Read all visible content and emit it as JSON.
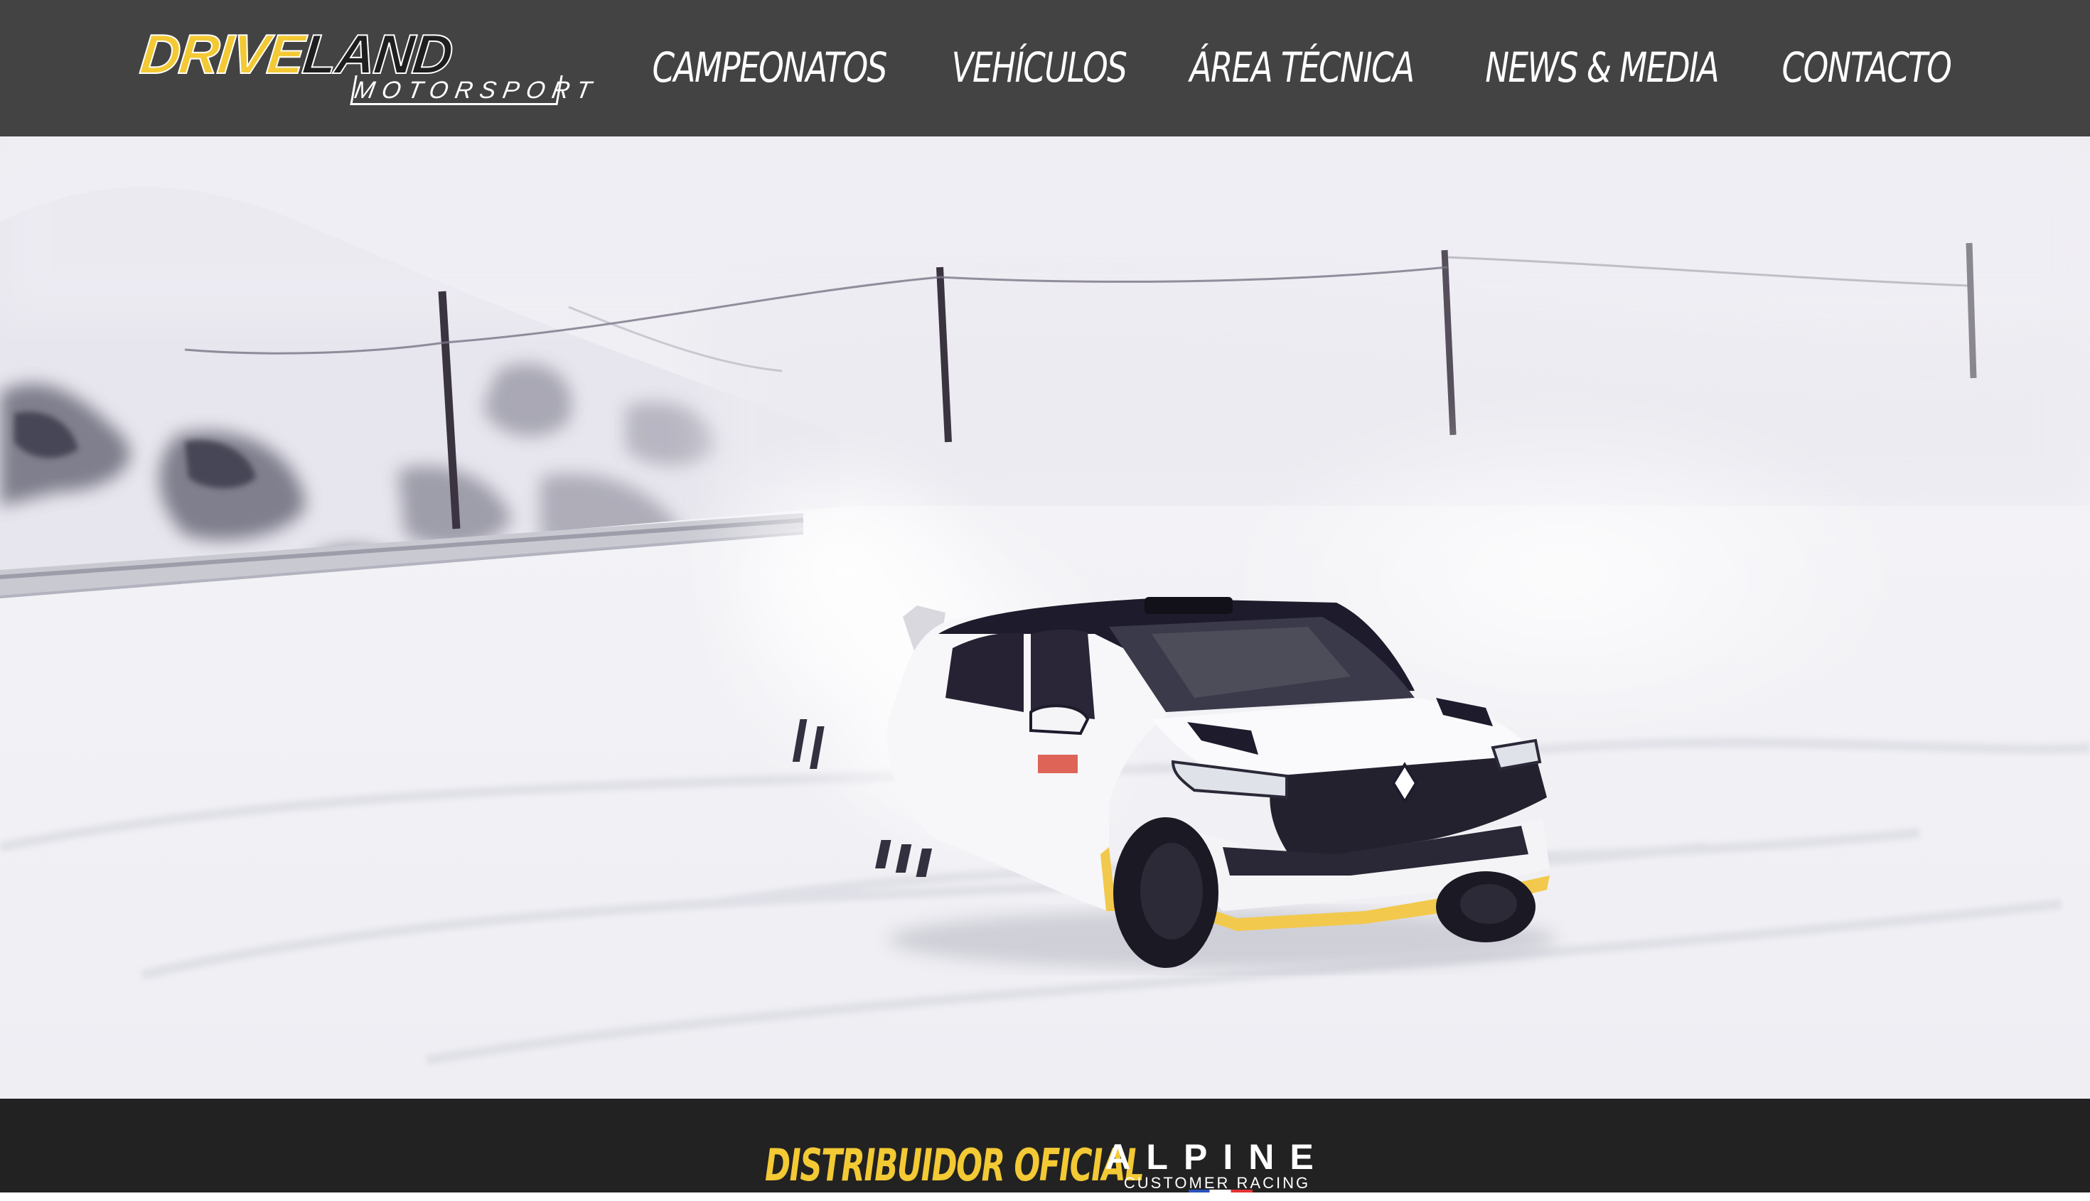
{
  "brand": {
    "logo_part1": "DRIVE",
    "logo_part2": "LAND",
    "logo_sub": "MOTORSPORT"
  },
  "nav": {
    "items": [
      {
        "label": "CAMPEONATOS"
      },
      {
        "label": "VEHÍCULOS"
      },
      {
        "label": "ÁREA TÉCNICA"
      },
      {
        "label": "NEWS & MEDIA"
      },
      {
        "label": "CONTACTO"
      }
    ]
  },
  "hero": {
    "scene": "snow-rally-video",
    "car_livery_colors": [
      "#ffffff",
      "#1e1b2c",
      "#f2c94c"
    ]
  },
  "footer": {
    "distributor_label": "DISTRIBUIDOR OFICIAL",
    "partner_word": "ALPINE",
    "partner_sub": "CUSTOMER RACING"
  },
  "colors": {
    "header_bg": "#434343",
    "footer_bg": "#222222",
    "accent_yellow": "#f3c934"
  }
}
